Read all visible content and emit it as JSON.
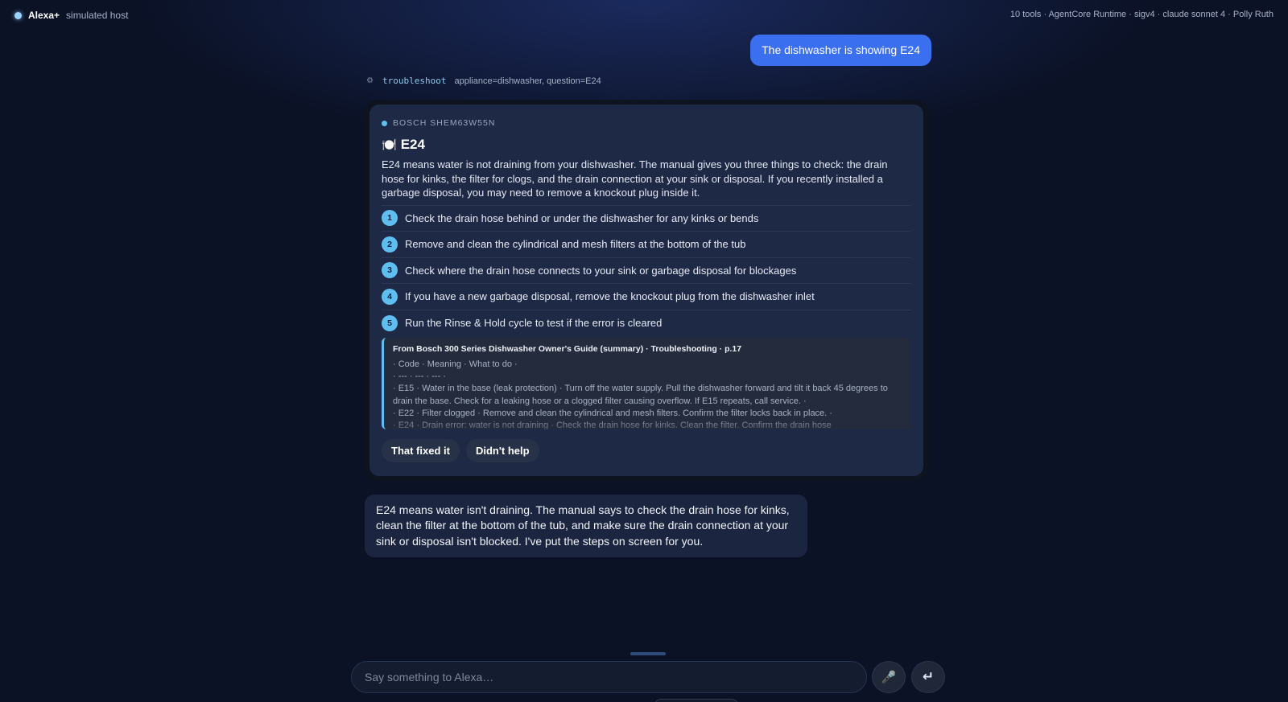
{
  "topbar": {
    "brand_name": "Alexa+",
    "brand_sub": "simulated host",
    "meta": "10 tools · AgentCore Runtime · sigv4 · claude sonnet 4 · Polly Ruth"
  },
  "conversation": {
    "user_message": "The dishwasher is showing E24",
    "tool_call": {
      "icon": "gear-icon",
      "name": "troubleshoot",
      "args": "appliance=dishwasher, question=E24"
    },
    "card": {
      "brand": "BOSCH SHEM63W55N",
      "icon": "🍽️",
      "title": "E24",
      "description": "E24 means water is not draining from your dishwasher. The manual gives you three things to check: the drain hose for kinks, the filter for clogs, and the drain connection at your sink or disposal. If you recently installed a garbage disposal, you may need to remove a knockout plug inside it.",
      "steps": [
        {
          "num": "1",
          "text": "Check the drain hose behind or under the dishwasher for any kinks or bends"
        },
        {
          "num": "2",
          "text": "Remove and clean the cylindrical and mesh filters at the bottom of the tub"
        },
        {
          "num": "3",
          "text": "Check where the drain hose connects to your sink or garbage disposal for blockages"
        },
        {
          "num": "4",
          "text": "If you have a new garbage disposal, remove the knockout plug from the dishwasher inlet"
        },
        {
          "num": "5",
          "text": "Run the Rinse & Hold cycle to test if the error is cleared"
        }
      ],
      "source": {
        "title": "From Bosch 300 Series Dishwasher Owner's Guide (summary) · Troubleshooting · p.17",
        "text": " · Code · Meaning · What to do · \n · --- · --- · --- · \n · E15 · Water in the base (leak protection) · Turn off the water supply. Pull the dishwasher forward and tilt it back 45 degrees to drain the base. Check for a leaking hose or a clogged filter causing overflow. If E15 repeats, call service. · \n · E22 · Filter clogged · Remove and clean the cylindrical and mesh filters. Confirm the filter locks back in place. · \n · E24 · Drain error: water is not draining · Check the drain hose for kinks. Clean the filter. Confirm the drain hose"
      },
      "actions": {
        "fixed_label": "That fixed it",
        "didnt_help_label": "Didn't help"
      }
    },
    "assistant_message": "E24 means water isn't draining. The manual says to check the drain hose for kinks, clean the filter at the bottom of the tub, and make sure the drain connection at your sink or disposal isn't blocked. I've put the steps on screen for you."
  },
  "composer": {
    "placeholder": "Say something to Alexa…",
    "mic_icon": "microphone-icon",
    "send_icon": "enter-icon"
  },
  "colors": {
    "background": "#0b1226",
    "user_bubble": "#3a6ff0",
    "card": "#1e2946",
    "accent": "#5fbdf0",
    "assistant_bubble": "#1b2540"
  }
}
